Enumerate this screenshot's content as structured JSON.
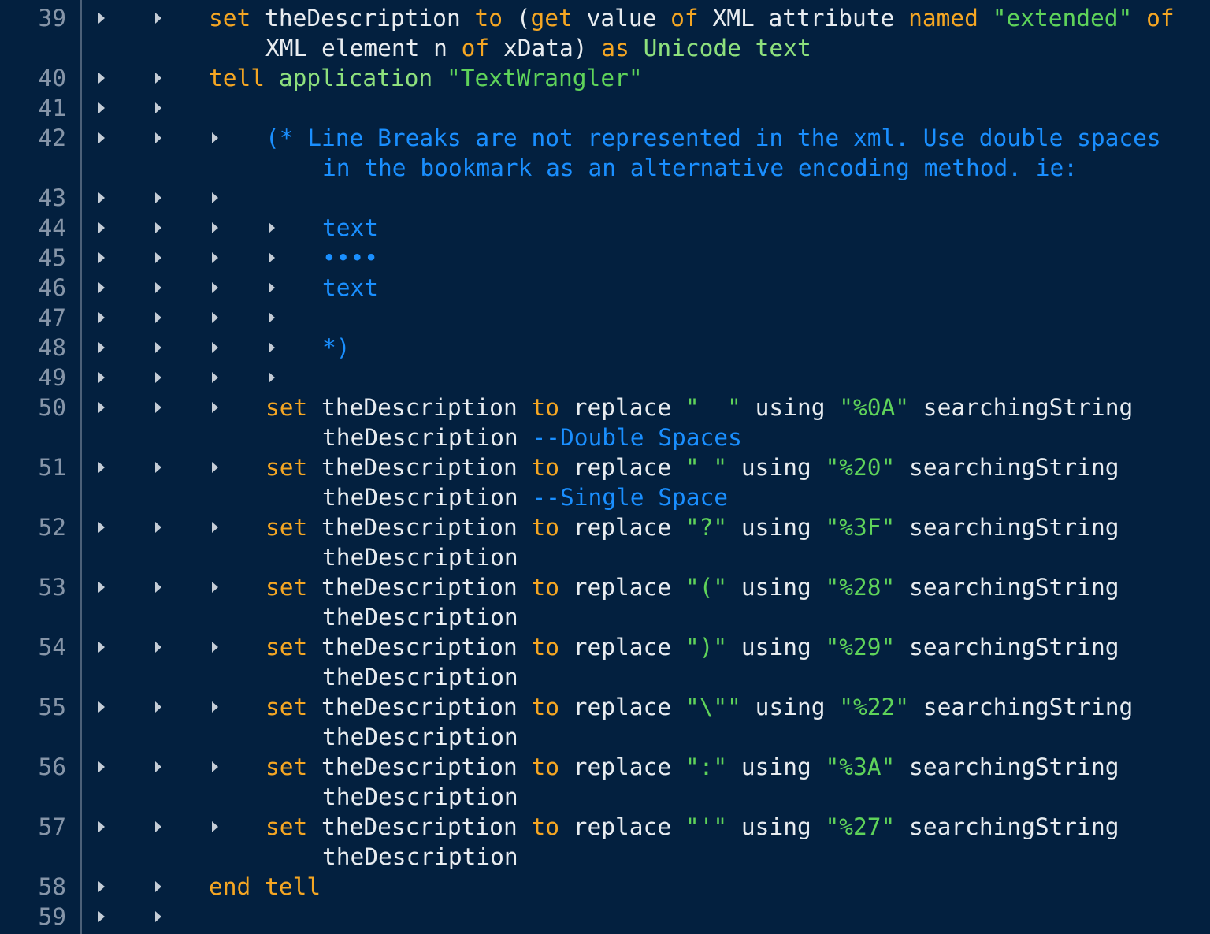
{
  "editor": {
    "lines": [
      {
        "num": "39",
        "tabs": 2,
        "row": 0,
        "tokens": [
          {
            "t": "set",
            "c": "kw"
          },
          {
            "t": " theDescription ",
            "c": "id"
          },
          {
            "t": "to",
            "c": "kw"
          },
          {
            "t": " (",
            "c": "id"
          },
          {
            "t": "get",
            "c": "kw"
          },
          {
            "t": " value ",
            "c": "id"
          },
          {
            "t": "of",
            "c": "kw"
          },
          {
            "t": " XML attribute ",
            "c": "id"
          },
          {
            "t": "named",
            "c": "kw"
          },
          {
            "t": " ",
            "c": "id"
          },
          {
            "t": "\"extended\"",
            "c": "str"
          },
          {
            "t": " ",
            "c": "id"
          },
          {
            "t": "of",
            "c": "kw"
          }
        ]
      },
      {
        "num": "",
        "tabs": 0,
        "row": 1,
        "indent": "cont",
        "tokens": [
          {
            "t": "XML element n ",
            "c": "id"
          },
          {
            "t": "of",
            "c": "kw"
          },
          {
            "t": " xData) ",
            "c": "id"
          },
          {
            "t": "as",
            "c": "kw"
          },
          {
            "t": " ",
            "c": "id"
          },
          {
            "t": "Unicode text",
            "c": "cls"
          }
        ]
      },
      {
        "num": "40",
        "tabs": 2,
        "row": 2,
        "tokens": [
          {
            "t": "tell",
            "c": "kw"
          },
          {
            "t": " ",
            "c": "id"
          },
          {
            "t": "application",
            "c": "cls"
          },
          {
            "t": " ",
            "c": "id"
          },
          {
            "t": "\"TextWrangler\"",
            "c": "str"
          }
        ]
      },
      {
        "num": "41",
        "tabs": 2,
        "row": 3,
        "tokens": []
      },
      {
        "num": "42",
        "tabs": 3,
        "row": 4,
        "indent": "l3",
        "tokens": [
          {
            "t": "(* Line Breaks are not represented in the xml. Use double spaces",
            "c": "cmt"
          }
        ]
      },
      {
        "num": "",
        "tabs": 0,
        "row": 5,
        "indent": "l3cont",
        "tokens": [
          {
            "t": "in the bookmark as an alternative encoding method. ie:",
            "c": "cmt"
          }
        ]
      },
      {
        "num": "43",
        "tabs": 3,
        "row": 6,
        "tokens": []
      },
      {
        "num": "44",
        "tabs": 4,
        "row": 7,
        "indent": "l4",
        "tokens": [
          {
            "t": "text",
            "c": "cmt"
          }
        ]
      },
      {
        "num": "45",
        "tabs": 4,
        "row": 8,
        "indent": "l4",
        "tokens": [
          {
            "t": "••••",
            "c": "cmt"
          }
        ]
      },
      {
        "num": "46",
        "tabs": 4,
        "row": 9,
        "indent": "l4",
        "tokens": [
          {
            "t": "text",
            "c": "cmt"
          }
        ]
      },
      {
        "num": "47",
        "tabs": 4,
        "row": 10,
        "tokens": []
      },
      {
        "num": "48",
        "tabs": 4,
        "row": 11,
        "indent": "l4",
        "tokens": [
          {
            "t": "*)",
            "c": "cmt"
          }
        ]
      },
      {
        "num": "49",
        "tabs": 4,
        "row": 12,
        "tokens": []
      },
      {
        "num": "50",
        "tabs": 3,
        "row": 13,
        "indent": "l3",
        "tokens": [
          {
            "t": "set",
            "c": "kw"
          },
          {
            "t": " theDescription ",
            "c": "id"
          },
          {
            "t": "to",
            "c": "kw"
          },
          {
            "t": " replace ",
            "c": "id"
          },
          {
            "t": "\"  \"",
            "c": "str"
          },
          {
            "t": " using ",
            "c": "id"
          },
          {
            "t": "\"%0A\"",
            "c": "str"
          },
          {
            "t": " searchingString",
            "c": "id"
          }
        ]
      },
      {
        "num": "",
        "tabs": 0,
        "row": 14,
        "indent": "l3cont",
        "tokens": [
          {
            "t": "theDescription ",
            "c": "id"
          },
          {
            "t": "--Double Spaces",
            "c": "cmt"
          }
        ]
      },
      {
        "num": "51",
        "tabs": 3,
        "row": 15,
        "indent": "l3",
        "tokens": [
          {
            "t": "set",
            "c": "kw"
          },
          {
            "t": " theDescription ",
            "c": "id"
          },
          {
            "t": "to",
            "c": "kw"
          },
          {
            "t": " replace ",
            "c": "id"
          },
          {
            "t": "\" \"",
            "c": "str"
          },
          {
            "t": " using ",
            "c": "id"
          },
          {
            "t": "\"%20\"",
            "c": "str"
          },
          {
            "t": " searchingString",
            "c": "id"
          }
        ]
      },
      {
        "num": "",
        "tabs": 0,
        "row": 16,
        "indent": "l3cont",
        "tokens": [
          {
            "t": "theDescription ",
            "c": "id"
          },
          {
            "t": "--Single Space",
            "c": "cmt"
          }
        ]
      },
      {
        "num": "52",
        "tabs": 3,
        "row": 17,
        "indent": "l3",
        "tokens": [
          {
            "t": "set",
            "c": "kw"
          },
          {
            "t": " theDescription ",
            "c": "id"
          },
          {
            "t": "to",
            "c": "kw"
          },
          {
            "t": " replace ",
            "c": "id"
          },
          {
            "t": "\"?\"",
            "c": "str"
          },
          {
            "t": " using ",
            "c": "id"
          },
          {
            "t": "\"%3F\"",
            "c": "str"
          },
          {
            "t": " searchingString",
            "c": "id"
          }
        ]
      },
      {
        "num": "",
        "tabs": 0,
        "row": 18,
        "indent": "l3cont",
        "tokens": [
          {
            "t": "theDescription",
            "c": "id"
          }
        ]
      },
      {
        "num": "53",
        "tabs": 3,
        "row": 19,
        "indent": "l3",
        "tokens": [
          {
            "t": "set",
            "c": "kw"
          },
          {
            "t": " theDescription ",
            "c": "id"
          },
          {
            "t": "to",
            "c": "kw"
          },
          {
            "t": " replace ",
            "c": "id"
          },
          {
            "t": "\"(\"",
            "c": "str"
          },
          {
            "t": " using ",
            "c": "id"
          },
          {
            "t": "\"%28\"",
            "c": "str"
          },
          {
            "t": " searchingString",
            "c": "id"
          }
        ]
      },
      {
        "num": "",
        "tabs": 0,
        "row": 20,
        "indent": "l3cont",
        "tokens": [
          {
            "t": "theDescription",
            "c": "id"
          }
        ]
      },
      {
        "num": "54",
        "tabs": 3,
        "row": 21,
        "indent": "l3",
        "tokens": [
          {
            "t": "set",
            "c": "kw"
          },
          {
            "t": " theDescription ",
            "c": "id"
          },
          {
            "t": "to",
            "c": "kw"
          },
          {
            "t": " replace ",
            "c": "id"
          },
          {
            "t": "\")\"",
            "c": "str"
          },
          {
            "t": " using ",
            "c": "id"
          },
          {
            "t": "\"%29\"",
            "c": "str"
          },
          {
            "t": " searchingString",
            "c": "id"
          }
        ]
      },
      {
        "num": "",
        "tabs": 0,
        "row": 22,
        "indent": "l3cont",
        "tokens": [
          {
            "t": "theDescription",
            "c": "id"
          }
        ]
      },
      {
        "num": "55",
        "tabs": 3,
        "row": 23,
        "indent": "l3",
        "tokens": [
          {
            "t": "set",
            "c": "kw"
          },
          {
            "t": " theDescription ",
            "c": "id"
          },
          {
            "t": "to",
            "c": "kw"
          },
          {
            "t": " replace ",
            "c": "id"
          },
          {
            "t": "\"\\\"\"",
            "c": "str"
          },
          {
            "t": " using ",
            "c": "id"
          },
          {
            "t": "\"%22\"",
            "c": "str"
          },
          {
            "t": " searchingString",
            "c": "id"
          }
        ]
      },
      {
        "num": "",
        "tabs": 0,
        "row": 24,
        "indent": "l3cont",
        "tokens": [
          {
            "t": "theDescription",
            "c": "id"
          }
        ]
      },
      {
        "num": "56",
        "tabs": 3,
        "row": 25,
        "indent": "l3",
        "tokens": [
          {
            "t": "set",
            "c": "kw"
          },
          {
            "t": " theDescription ",
            "c": "id"
          },
          {
            "t": "to",
            "c": "kw"
          },
          {
            "t": " replace ",
            "c": "id"
          },
          {
            "t": "\":\"",
            "c": "str"
          },
          {
            "t": " using ",
            "c": "id"
          },
          {
            "t": "\"%3A\"",
            "c": "str"
          },
          {
            "t": " searchingString",
            "c": "id"
          }
        ]
      },
      {
        "num": "",
        "tabs": 0,
        "row": 26,
        "indent": "l3cont",
        "tokens": [
          {
            "t": "theDescription",
            "c": "id"
          }
        ]
      },
      {
        "num": "57",
        "tabs": 3,
        "row": 27,
        "indent": "l3",
        "tokens": [
          {
            "t": "set",
            "c": "kw"
          },
          {
            "t": " theDescription ",
            "c": "id"
          },
          {
            "t": "to",
            "c": "kw"
          },
          {
            "t": " replace ",
            "c": "id"
          },
          {
            "t": "\"'\"",
            "c": "str"
          },
          {
            "t": " using ",
            "c": "id"
          },
          {
            "t": "\"%27\"",
            "c": "str"
          },
          {
            "t": " searchingString",
            "c": "id"
          }
        ]
      },
      {
        "num": "",
        "tabs": 0,
        "row": 28,
        "indent": "l3cont",
        "tokens": [
          {
            "t": "theDescription",
            "c": "id"
          }
        ]
      },
      {
        "num": "58",
        "tabs": 2,
        "row": 29,
        "tokens": [
          {
            "t": "end",
            "c": "kw"
          },
          {
            "t": " ",
            "c": "id"
          },
          {
            "t": "tell",
            "c": "kw"
          }
        ]
      },
      {
        "num": "59",
        "tabs": 2,
        "row": 30,
        "tokens": []
      }
    ],
    "colors": {
      "background": "#03203f",
      "keyword": "#f5a623",
      "class": "#8ee07d",
      "string": "#5fd35a",
      "comment": "#1a8fff",
      "identifier": "#e8ecf0",
      "line_number": "#8695a8",
      "tab_marker": "#c4ccd6"
    }
  }
}
